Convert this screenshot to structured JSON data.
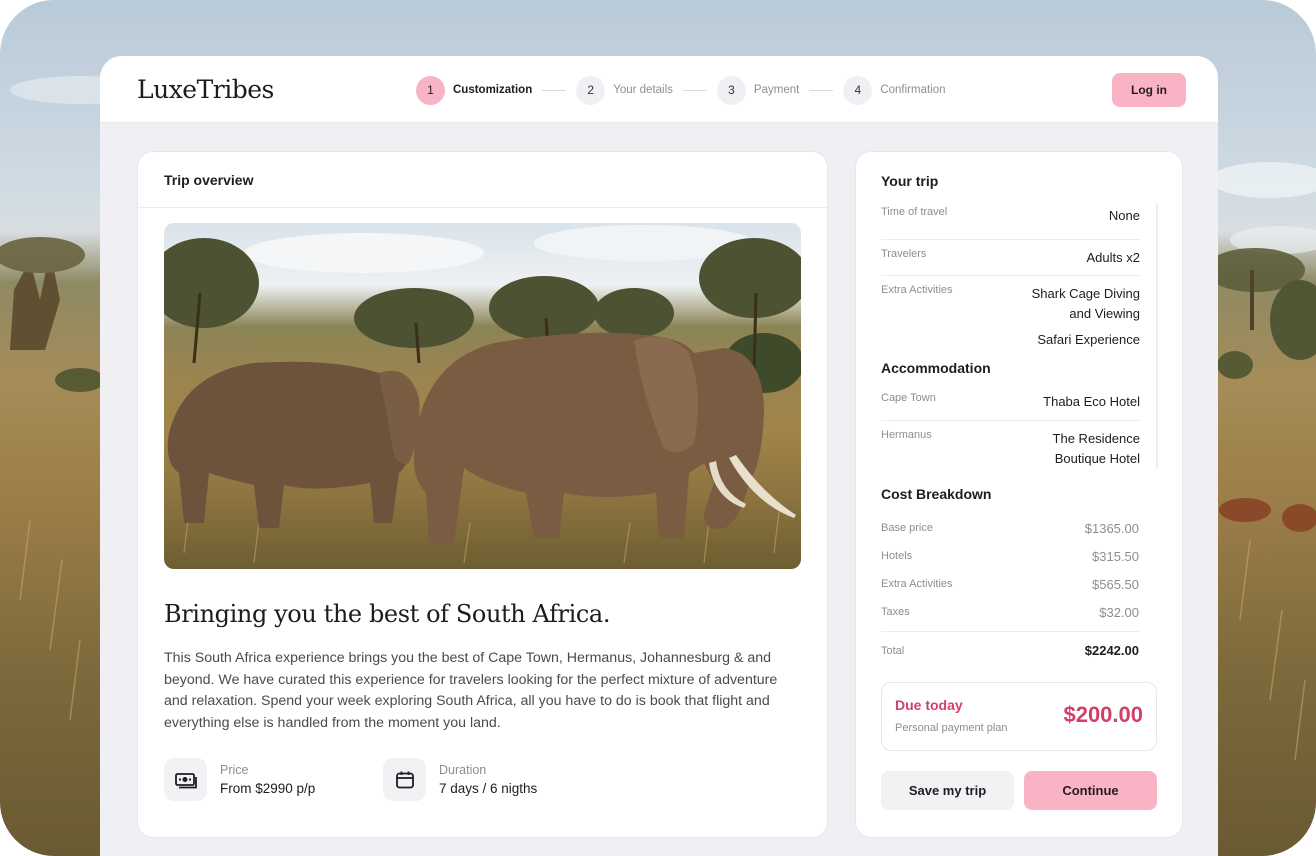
{
  "brand": "LuxeTribes",
  "stepper": [
    {
      "num": "1",
      "label": "Customization",
      "active": true
    },
    {
      "num": "2",
      "label": "Your details",
      "active": false
    },
    {
      "num": "3",
      "label": "Payment",
      "active": false
    },
    {
      "num": "4",
      "label": "Confirmation",
      "active": false
    }
  ],
  "header": {
    "login_label": "Log in"
  },
  "overview": {
    "title": "Trip overview",
    "headline": "Bringing you the best of South Africa.",
    "description": "This South Africa experience brings you the best of Cape Town, Hermanus, Johannesburg & and beyond. We have curated this experience for travelers looking for the perfect mixture of adventure and relaxation. Spend your week exploring South Africa, all you have to do is book that flight and everything else is handled from the moment you land.",
    "price_label": "Price",
    "price_value": "From $2990 p/p",
    "price_icon": "money-icon",
    "duration_label": "Duration",
    "duration_value": "7 days / 6 nigths",
    "duration_icon": "calendar-icon"
  },
  "trip": {
    "title": "Your trip",
    "rows": [
      {
        "label": "Time of travel",
        "value": "None"
      },
      {
        "label": "Travelers",
        "value": "Adults x2"
      },
      {
        "label": "Extra Activities",
        "value": "Shark Cage Diving and Viewing",
        "value2": "Safari Experience"
      }
    ]
  },
  "accommodation": {
    "title": "Accommodation",
    "rows": [
      {
        "label": "Cape Town",
        "value": "Thaba Eco Hotel"
      },
      {
        "label": "Hermanus",
        "value": "The Residence Boutique Hotel"
      }
    ]
  },
  "costs": {
    "title": "Cost Breakdown",
    "rows": [
      {
        "label": "Base price",
        "value": "$1365.00"
      },
      {
        "label": "Hotels",
        "value": "$315.50"
      },
      {
        "label": "Extra Activities",
        "value": "$565.50"
      },
      {
        "label": "Taxes",
        "value": "$32.00"
      }
    ],
    "total_label": "Total",
    "total_value": "$2242.00"
  },
  "due": {
    "title": "Due today",
    "subtitle": "Personal payment plan",
    "amount": "$200.00"
  },
  "actions": {
    "save_label": "Save my trip",
    "continue_label": "Continue"
  },
  "colors": {
    "accent_pink": "#f8b4c5",
    "due_red": "#d43f67",
    "panel_bg": "#f0f0f4"
  }
}
